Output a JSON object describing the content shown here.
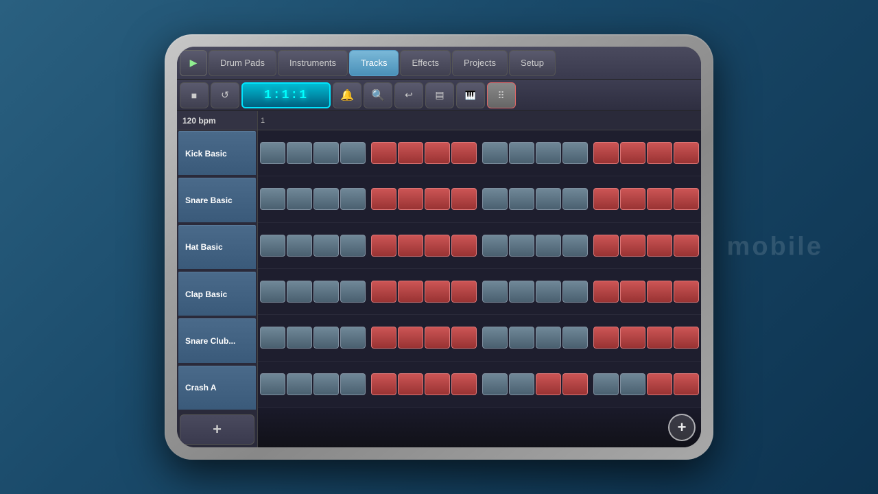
{
  "tablet": {
    "nav_tabs": [
      {
        "id": "drum-pads",
        "label": "Drum Pads",
        "active": false
      },
      {
        "id": "instruments",
        "label": "Instruments",
        "active": false
      },
      {
        "id": "tracks",
        "label": "Tracks",
        "active": true
      },
      {
        "id": "effects",
        "label": "Effects",
        "active": false
      },
      {
        "id": "projects",
        "label": "Projects",
        "active": false
      },
      {
        "id": "setup",
        "label": "Setup",
        "active": false
      }
    ],
    "play_icon": "▶",
    "bpm": "120 bpm",
    "bpm_display": "1:1:1",
    "measure_label": "1",
    "tracks": [
      {
        "id": "kick-basic",
        "label": "Kick Basic",
        "pads": [
          0,
          0,
          0,
          0,
          1,
          1,
          1,
          1,
          0,
          0,
          0,
          0,
          1,
          1,
          1,
          1
        ]
      },
      {
        "id": "snare-basic",
        "label": "Snare Basic",
        "pads": [
          0,
          0,
          0,
          0,
          1,
          1,
          1,
          1,
          0,
          0,
          0,
          0,
          1,
          1,
          1,
          1
        ]
      },
      {
        "id": "hat-basic",
        "label": "Hat Basic",
        "pads": [
          0,
          0,
          0,
          0,
          1,
          1,
          1,
          1,
          0,
          0,
          0,
          0,
          1,
          1,
          1,
          1
        ]
      },
      {
        "id": "clap-basic",
        "label": "Clap Basic",
        "pads": [
          0,
          0,
          0,
          0,
          1,
          1,
          1,
          1,
          0,
          0,
          0,
          0,
          1,
          1,
          1,
          1
        ]
      },
      {
        "id": "snare-club",
        "label": "Snare Club...",
        "pads": [
          0,
          0,
          0,
          0,
          1,
          1,
          1,
          1,
          0,
          0,
          0,
          0,
          1,
          1,
          1,
          1
        ]
      },
      {
        "id": "crash-a",
        "label": "Crash A",
        "pads": [
          0,
          0,
          0,
          0,
          1,
          1,
          1,
          1,
          0,
          0,
          0,
          0,
          1,
          1,
          1,
          1
        ]
      }
    ],
    "toolbar": {
      "stop_label": "■",
      "loop_label": "↺",
      "undo_label": "↩",
      "list_label": "≡",
      "piano_label": "🎹",
      "grid_label": "⊞"
    },
    "add_track_label": "+",
    "add_pattern_label": "+"
  }
}
